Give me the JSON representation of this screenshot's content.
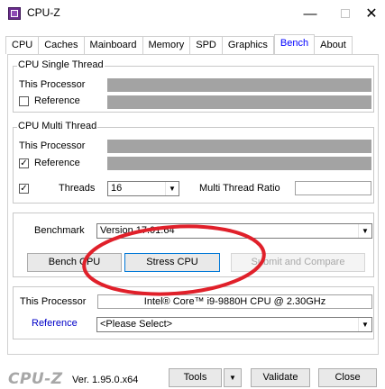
{
  "window": {
    "title": "CPU-Z"
  },
  "tabs": [
    {
      "label": "CPU"
    },
    {
      "label": "Caches"
    },
    {
      "label": "Mainboard"
    },
    {
      "label": "Memory"
    },
    {
      "label": "SPD"
    },
    {
      "label": "Graphics"
    },
    {
      "label": "Bench",
      "active": true
    },
    {
      "label": "About"
    }
  ],
  "single_thread": {
    "title": "CPU Single Thread",
    "this_processor_label": "This Processor",
    "reference_label": "Reference",
    "reference_checked": false
  },
  "multi_thread": {
    "title": "CPU Multi Thread",
    "this_processor_label": "This Processor",
    "reference_label": "Reference",
    "reference_checked": true,
    "threads_label": "Threads",
    "threads_checked": true,
    "threads_value": "16",
    "ratio_label": "Multi Thread Ratio",
    "ratio_value": ""
  },
  "benchmark": {
    "label": "Benchmark",
    "version_value": "Version 17.01.64",
    "bench_cpu_label": "Bench CPU",
    "stress_cpu_label": "Stress CPU",
    "submit_label": "Submit and Compare"
  },
  "processor": {
    "this_processor_label": "This Processor",
    "name": "Intel® Core™ i9-9880H CPU @ 2.30GHz",
    "reference_label": "Reference",
    "reference_value": "<Please Select>"
  },
  "footer": {
    "logo": "CPU-Z",
    "version": "Ver. 1.95.0.x64",
    "tools_label": "Tools",
    "validate_label": "Validate",
    "close_label": "Close"
  },
  "colors": {
    "annotation": "#e0202a",
    "active_tab": "#0000ff",
    "bar_gray": "#a3a3a3"
  }
}
